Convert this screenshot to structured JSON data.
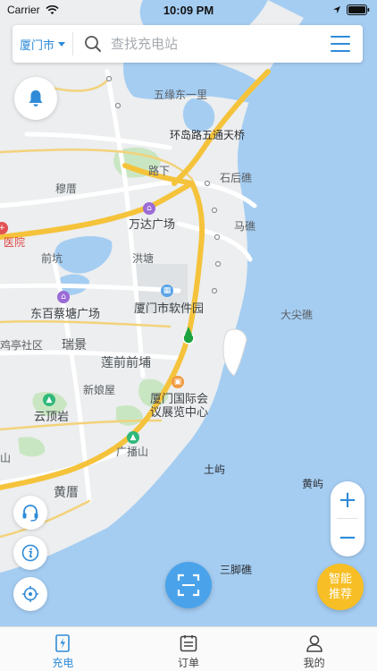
{
  "status_bar": {
    "carrier": "Carrier",
    "time": "10:09 PM"
  },
  "search": {
    "city": "厦门市",
    "placeholder": "查找充电站"
  },
  "map": {
    "labels": {
      "wuyuan": "五缘东一里",
      "bridge": "环岛路五通天桥",
      "shihou": "石后礁",
      "luxia": "路下",
      "mucuo": "穆厝",
      "wanda": "万达广场",
      "maiao": "马礁",
      "hospital": "医院",
      "qiankeng": "前坑",
      "hongtang": "洪塘",
      "software": "厦门市软件园",
      "dongbai": "东百蔡塘广场",
      "dajianjiao": "大尖礁",
      "tingshe": "鸡亭社区",
      "ruijing": "瑞景",
      "lianqian": "莲前前埔",
      "xinniangwu": "新娘屋",
      "convention_1": "厦门国际会",
      "convention_2": "议展览中心",
      "yunding": "云顶岩",
      "guangbo": "广播山",
      "tuyu": "土屿",
      "huangyu": "黄屿",
      "huangcuo": "黄厝",
      "sanjiaojiao": "三脚礁",
      "shan": "山"
    }
  },
  "zoom": {
    "plus": "+",
    "minus": "−"
  },
  "smart_button": {
    "line1": "智能",
    "line2": "推荐"
  },
  "tabs": [
    {
      "label": "充电",
      "icon": "charging-icon",
      "active": true
    },
    {
      "label": "订单",
      "icon": "orders-icon",
      "active": false
    },
    {
      "label": "我的",
      "icon": "profile-icon",
      "active": false
    }
  ],
  "colors": {
    "accent": "#2f8bd8",
    "sea": "#a5cdf2",
    "highway": "#f5c33b",
    "smart": "#f7bf25",
    "scan": "#4aa3ea"
  }
}
